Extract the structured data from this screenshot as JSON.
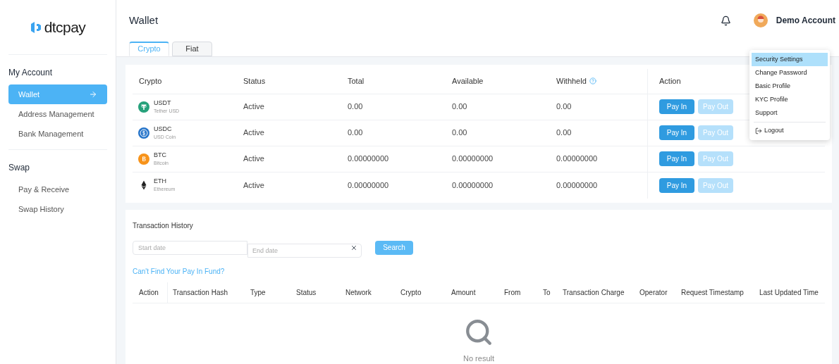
{
  "logo": {
    "text": "dtcpay"
  },
  "sidebar": {
    "sections": [
      {
        "title": "My Account",
        "items": [
          {
            "label": "Wallet",
            "selected": true
          },
          {
            "label": "Address Management",
            "selected": false
          },
          {
            "label": "Bank Management",
            "selected": false
          }
        ]
      },
      {
        "title": "Swap",
        "items": [
          {
            "label": "Pay & Receive",
            "selected": false
          },
          {
            "label": "Swap History",
            "selected": false
          }
        ]
      }
    ]
  },
  "header": {
    "title": "Wallet",
    "user": "Demo Account"
  },
  "tabs": [
    {
      "label": "Crypto",
      "selected": true
    },
    {
      "label": "Fiat",
      "selected": false
    }
  ],
  "wallet_table": {
    "columns": [
      "Crypto",
      "Status",
      "Total",
      "Available",
      "Withheld",
      "Action"
    ],
    "rows": [
      {
        "kind": "usdt",
        "symbol": "USDT",
        "name": "Tether USD",
        "status": "Active",
        "total": "0.00",
        "available": "0.00",
        "withheld": "0.00",
        "actions": [
          {
            "label": "Pay In",
            "disabled": false
          },
          {
            "label": "Pay Out",
            "disabled": true
          }
        ]
      },
      {
        "kind": "usdc",
        "symbol": "USDC",
        "name": "USD Coin",
        "status": "Active",
        "total": "0.00",
        "available": "0.00",
        "withheld": "0.00",
        "actions": [
          {
            "label": "Pay In",
            "disabled": false
          },
          {
            "label": "Pay Out",
            "disabled": true
          }
        ]
      },
      {
        "kind": "btc",
        "symbol": "BTC",
        "name": "Bitcoin",
        "status": "Active",
        "total": "0.00000000",
        "available": "0.00000000",
        "withheld": "0.00000000",
        "actions": [
          {
            "label": "Pay In",
            "disabled": false
          },
          {
            "label": "Pay Out",
            "disabled": true
          }
        ]
      },
      {
        "kind": "eth",
        "symbol": "ETH",
        "name": "Ethereum",
        "status": "Active",
        "total": "0.00000000",
        "available": "0.00000000",
        "withheld": "0.00000000",
        "actions": [
          {
            "label": "Pay In",
            "disabled": false
          },
          {
            "label": "Pay Out",
            "disabled": true
          }
        ]
      }
    ]
  },
  "transaction_history": {
    "title": "Transaction History",
    "start_placeholder": "Start date",
    "end_placeholder": "End date",
    "search_button": "Search",
    "link": "Can't Find Your Pay In Fund?",
    "columns": [
      "Action",
      "Transaction Hash",
      "Type",
      "Status",
      "Network",
      "Crypto",
      "Amount",
      "From",
      "To",
      "Transaction Charge",
      "Operator",
      "Request Timestamp",
      "Last Updated Time"
    ],
    "empty_text": "No result"
  },
  "user_menu": {
    "items": [
      {
        "kind": "item",
        "label": "Security Settings",
        "selected": true
      },
      {
        "kind": "item",
        "label": "Change Password",
        "selected": false
      },
      {
        "kind": "item",
        "label": "Basic Profile",
        "selected": false
      },
      {
        "kind": "item",
        "label": "KYC Profile",
        "selected": false
      },
      {
        "kind": "item",
        "label": "Support",
        "selected": false
      },
      {
        "kind": "logout",
        "label": "Logout",
        "selected": false
      }
    ]
  }
}
